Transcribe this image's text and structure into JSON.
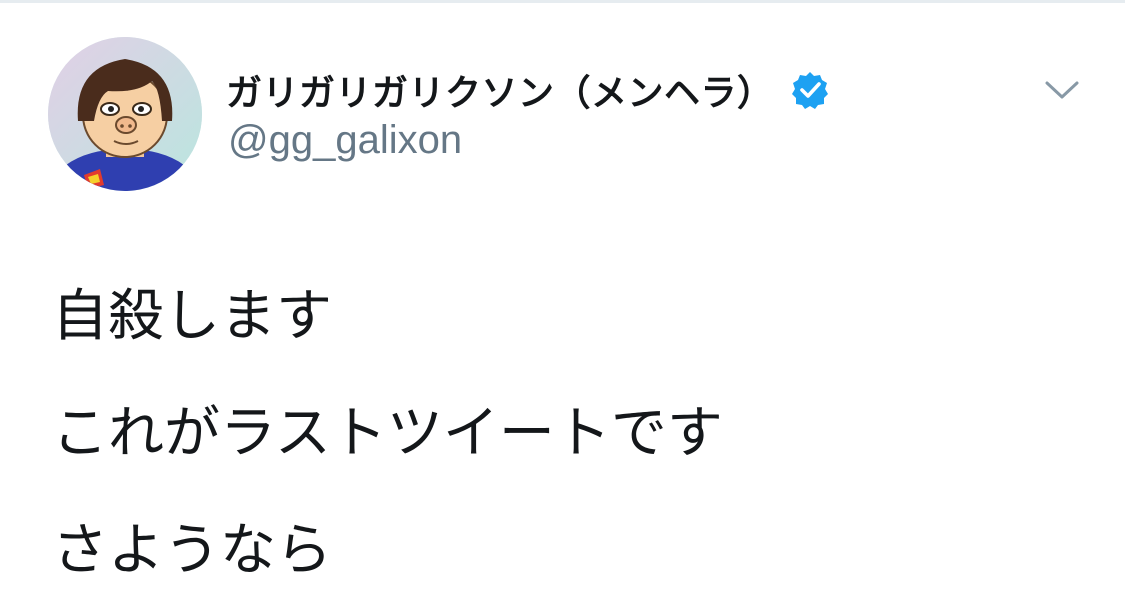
{
  "tweet": {
    "author": {
      "display_name": "ガリガリガリクソン（メンヘラ）",
      "handle": "@gg_galixon",
      "verified": true,
      "avatar_icon": "cartoon-avatar"
    },
    "text_lines": [
      "自殺します",
      "これがラストツイートです",
      "さようなら"
    ],
    "menu_icon": "chevron-down-icon"
  },
  "colors": {
    "text_primary": "#14171a",
    "text_secondary": "#657786",
    "verified_blue": "#1da1f2",
    "chevron": "#8899a6"
  }
}
